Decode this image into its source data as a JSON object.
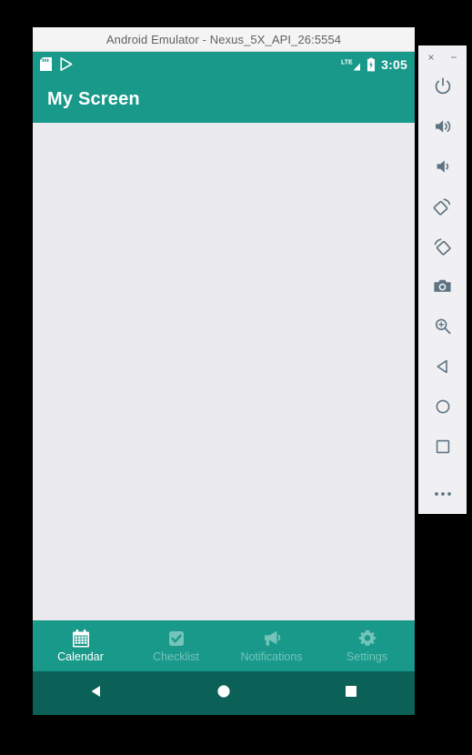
{
  "emulator": {
    "window_title": "Android Emulator - Nexus_5X_API_26:5554",
    "colors": {
      "app_bar": "#18998a",
      "status_bar": "#18998a",
      "content_background": "#eaeaee",
      "system_nav": "#0b6157",
      "active_tab": "#ffffff",
      "inactive_tab": "#76c3b9",
      "toolbar_background": "#f0f0f2",
      "toolbar_icon": "#5d7381"
    }
  },
  "status_bar": {
    "left_icons": [
      {
        "name": "sd-card-icon",
        "label": "SD card"
      },
      {
        "name": "play-store-icon",
        "label": "Play Store"
      }
    ],
    "network_label": "LTE",
    "right_icons": [
      {
        "name": "lte-signal-icon",
        "label": "LTE signal"
      },
      {
        "name": "battery-charging-icon",
        "label": "Battery charging"
      }
    ],
    "clock": "3:05"
  },
  "app_bar": {
    "title": "My Screen"
  },
  "content": {
    "body_text": ""
  },
  "bottom_nav": {
    "tabs": [
      {
        "label": "Calendar",
        "icon": "calendar-icon",
        "active": true
      },
      {
        "label": "Checklist",
        "icon": "checkbox-icon",
        "active": false
      },
      {
        "label": "Notifications",
        "icon": "megaphone-icon",
        "active": false
      },
      {
        "label": "Settings",
        "icon": "gear-icon",
        "active": false
      }
    ]
  },
  "system_nav": {
    "buttons": [
      {
        "name": "back-button",
        "icon": "triangle-back-icon"
      },
      {
        "name": "home-button",
        "icon": "circle-home-icon"
      },
      {
        "name": "recents-button",
        "icon": "square-recents-icon"
      }
    ]
  },
  "emulator_toolbar": {
    "window_controls": [
      {
        "name": "close-button",
        "glyph": "×"
      },
      {
        "name": "minimize-button",
        "glyph": "−"
      }
    ],
    "buttons": [
      {
        "name": "power-button",
        "icon": "power-icon"
      },
      {
        "name": "volume-up-button",
        "icon": "volume-up-icon"
      },
      {
        "name": "volume-down-button",
        "icon": "volume-down-icon"
      },
      {
        "name": "rotate-left-button",
        "icon": "rotate-left-icon"
      },
      {
        "name": "rotate-right-button",
        "icon": "rotate-right-icon"
      },
      {
        "name": "screenshot-button",
        "icon": "camera-icon"
      },
      {
        "name": "zoom-button",
        "icon": "zoom-in-icon"
      },
      {
        "name": "back-button",
        "icon": "triangle-back-icon"
      },
      {
        "name": "home-button",
        "icon": "circle-home-icon"
      },
      {
        "name": "overview-button",
        "icon": "square-recents-icon"
      },
      {
        "name": "more-button",
        "icon": "ellipsis-icon"
      }
    ]
  }
}
